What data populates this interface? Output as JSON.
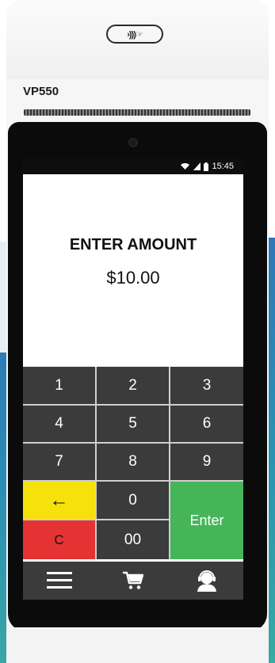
{
  "device": {
    "model": "VP550",
    "contactless_symbol": "›)))☞"
  },
  "status_bar": {
    "time": "15:45",
    "icons": [
      "wifi-icon",
      "signal-icon",
      "battery-icon"
    ]
  },
  "screen": {
    "title": "ENTER AMOUNT",
    "amount": "$10.00"
  },
  "keypad": {
    "keys": {
      "k1": "1",
      "k2": "2",
      "k3": "3",
      "k4": "4",
      "k5": "5",
      "k6": "6",
      "k7": "7",
      "k8": "8",
      "k9": "9",
      "back": "←",
      "k0": "0",
      "clear": "C",
      "k00": "00",
      "enter": "Enter"
    },
    "colors": {
      "digit": "#3b3b3b",
      "back": "#f5e20a",
      "clear": "#e53333",
      "enter": "#46b55a"
    }
  },
  "navbar": {
    "items": [
      "menu-icon",
      "cart-icon",
      "support-agent-icon"
    ]
  }
}
